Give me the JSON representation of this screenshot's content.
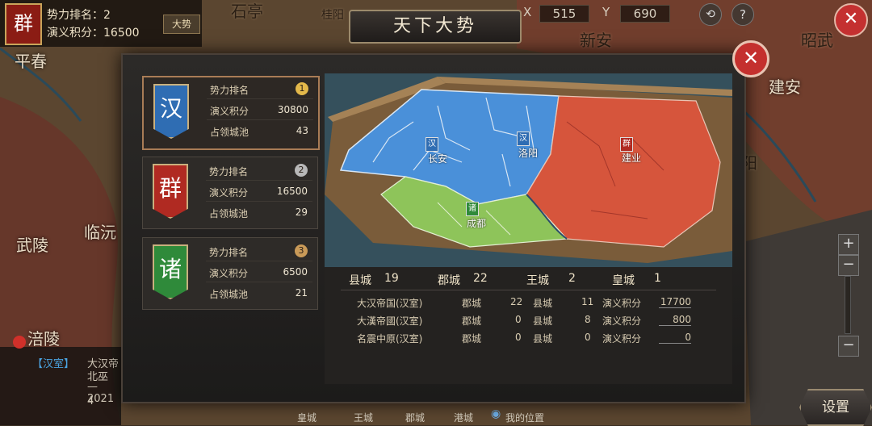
{
  "hud": {
    "faction_char": "群",
    "rank_line": "势力排名：2",
    "score_line": "演义积分：16500",
    "trend_button": "大势",
    "x_label": "X",
    "x_value": "515",
    "y_label": "Y",
    "y_value": "690"
  },
  "map_labels": [
    "石亭",
    "桂阳",
    "新安",
    "昭武",
    "建安",
    "平春",
    "临沅",
    "武陵",
    "涪陵",
    "阳"
  ],
  "dialog": {
    "title": "天下大势",
    "close_symbol": "✕",
    "factions": [
      {
        "char": "汉",
        "color": "#2f6db3",
        "rank_label": "势力排名",
        "rank": "1",
        "score_label": "演义积分",
        "score": "30800",
        "cities_label": "占领城池",
        "cities": "43"
      },
      {
        "char": "群",
        "color": "#b02a22",
        "rank_label": "势力排名",
        "rank": "2",
        "score_label": "演义积分",
        "score": "16500",
        "cities_label": "占领城池",
        "cities": "29"
      },
      {
        "char": "诸",
        "color": "#2f8a3a",
        "rank_label": "势力排名",
        "rank": "3",
        "score_label": "演义积分",
        "score": "6500",
        "cities_label": "占领城池",
        "cities": "21"
      }
    ],
    "minimap_markers": [
      {
        "char": "汉",
        "city": "长安"
      },
      {
        "char": "汉",
        "city": "洛阳"
      },
      {
        "char": "群",
        "city": "建业"
      },
      {
        "char": "诸",
        "city": "成都"
      }
    ],
    "city_counts": [
      {
        "label": "县城",
        "value": "19"
      },
      {
        "label": "郡城",
        "value": "22"
      },
      {
        "label": "王城",
        "value": "2"
      },
      {
        "label": "皇城",
        "value": "1"
      }
    ],
    "table": [
      {
        "name": "大汉帝国(汉室)",
        "jun_label": "郡城",
        "jun": "22",
        "xian_label": "县城",
        "xian": "11",
        "score_label": "演义积分",
        "score": "17700"
      },
      {
        "name": "大漢帝國(汉室)",
        "jun_label": "郡城",
        "jun": "0",
        "xian_label": "县城",
        "xian": "8",
        "score_label": "演义积分",
        "score": "800"
      },
      {
        "name": "名震中原(汉室)",
        "jun_label": "郡城",
        "jun": "0",
        "xian_label": "县城",
        "xian": "0",
        "score_label": "演义积分",
        "score": "0"
      }
    ]
  },
  "chat": {
    "tag": "【汉室】",
    "line1": "大汉帝",
    "line2": "北巫",
    "line3": "—2021",
    "line4": "4"
  },
  "bottom": {
    "items": [
      "皇城",
      "王城",
      "郡城",
      "港城",
      "我的位置"
    ]
  },
  "settings_label": "设置",
  "zoom": {
    "plus": "+",
    "minus": "−"
  }
}
